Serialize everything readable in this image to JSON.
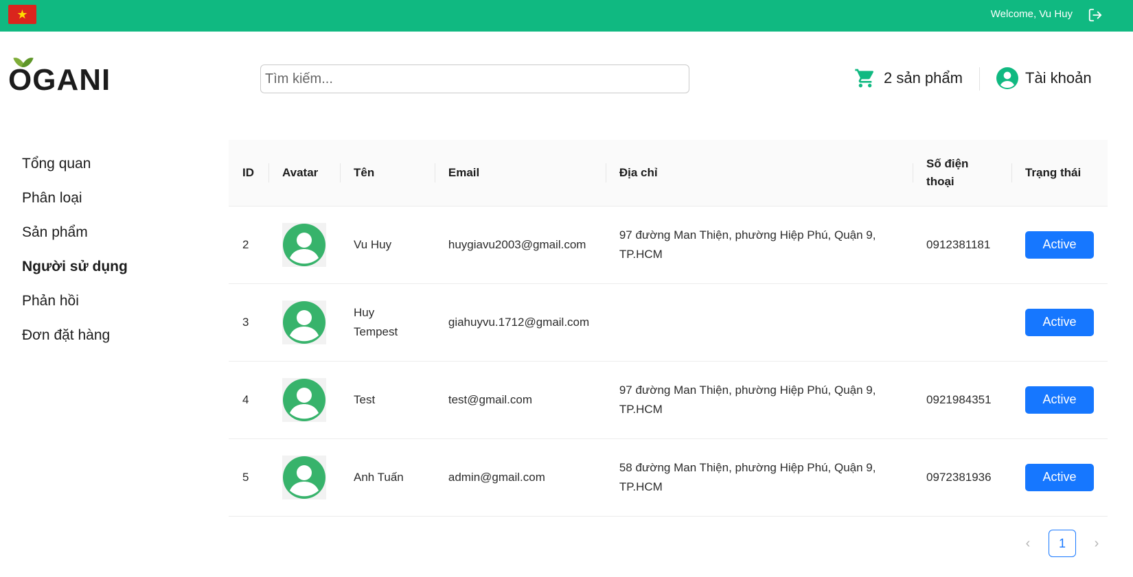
{
  "topbar": {
    "flag_icon": "vietnam-flag-icon",
    "welcome_text": "Welcome, Vu Huy",
    "logout_icon": "logout-icon",
    "bg_color": "#10b981"
  },
  "header": {
    "logo_text": "OGANI",
    "search_placeholder": "Tìm kiếm...",
    "cart_label": "2 sản phẩm",
    "account_label": "Tài khoản"
  },
  "sidebar": {
    "items": [
      {
        "label": "Tổng quan",
        "active": false
      },
      {
        "label": "Phân loại",
        "active": false
      },
      {
        "label": "Sản phẩm",
        "active": false
      },
      {
        "label": "Người sử dụng",
        "active": true
      },
      {
        "label": "Phản hồi",
        "active": false
      },
      {
        "label": "Đơn đặt hàng",
        "active": false
      }
    ]
  },
  "table": {
    "headers": {
      "id": "ID",
      "avatar": "Avatar",
      "name": "Tên",
      "email": "Email",
      "address": "Địa chỉ",
      "phone": "Số điện thoại",
      "status": "Trạng thái"
    },
    "rows": [
      {
        "id": "2",
        "name": "Vu Huy",
        "email": "huygiavu2003@gmail.com",
        "address": "97 đường Man Thiện, phường Hiệp Phú, Quận 9, TP.HCM",
        "phone": "0912381181",
        "status": "Active"
      },
      {
        "id": "3",
        "name": "Huy Tempest",
        "email": "giahuyvu.1712@gmail.com",
        "address": "",
        "phone": "",
        "status": "Active"
      },
      {
        "id": "4",
        "name": "Test",
        "email": "test@gmail.com",
        "address": "97 đường Man Thiện, phường Hiệp Phú, Quận 9, TP.HCM",
        "phone": "0921984351",
        "status": "Active"
      },
      {
        "id": "5",
        "name": "Anh Tuấn",
        "email": "admin@gmail.com",
        "address": "58 đường Man Thiện, phường Hiệp Phú, Quận 9, TP.HCM",
        "phone": "0972381936",
        "status": "Active"
      }
    ]
  },
  "pagination": {
    "prev_icon": "chevron-left-icon",
    "current_page": "1",
    "next_icon": "chevron-right-icon"
  },
  "colors": {
    "accent_green": "#10b981",
    "active_blue": "#1677ff"
  }
}
